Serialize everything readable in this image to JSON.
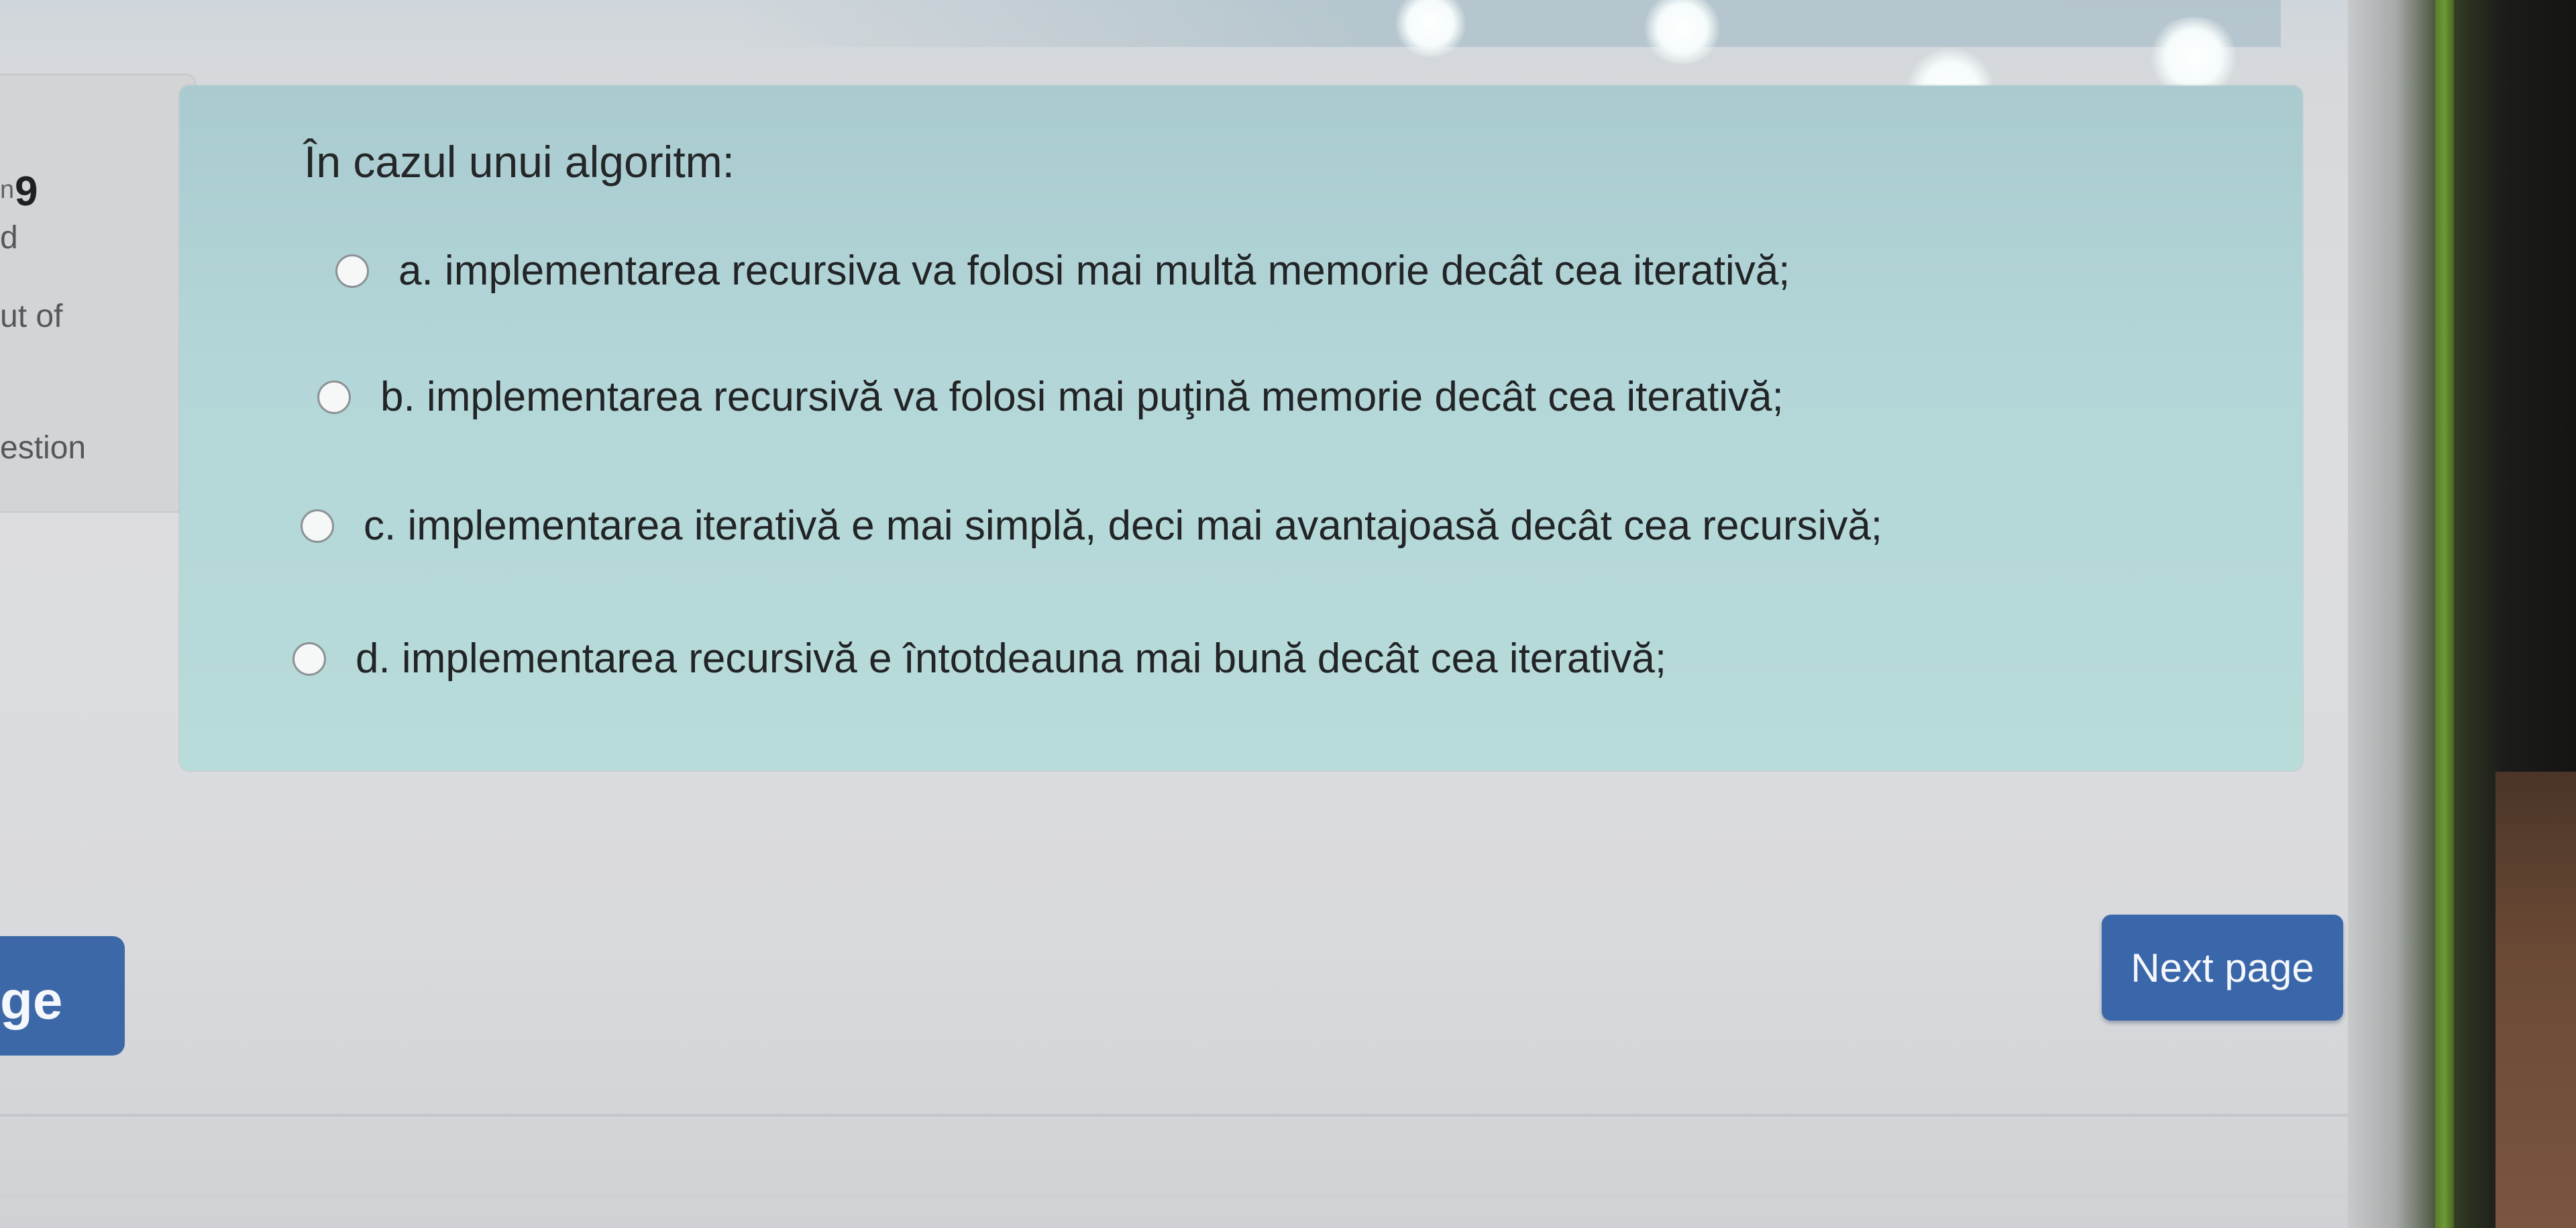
{
  "info_panel": {
    "question_prefix": "n",
    "question_number": "9",
    "status_fragment": "d",
    "marks_fragment": "ut of",
    "flag_fragment": "estion"
  },
  "question": {
    "text": "În cazul unui algoritm:",
    "options": [
      {
        "label": "a. implementarea recursiva va folosi mai multă memorie decât cea iterativă;"
      },
      {
        "label": "b. implementarea recursivă va folosi mai puţină memorie decât cea iterativă;"
      },
      {
        "label": "c. implementarea iterativă e mai simplă, deci mai avantajoasă decât cea recursivă;"
      },
      {
        "label": "d. implementarea recursivă e întotdeauna mai bună decât cea iterativă;"
      }
    ]
  },
  "navigation": {
    "previous_fragment": "ge",
    "next_label": "Next page"
  },
  "colors": {
    "question_background": "#b3d6d8",
    "button_primary": "#3a66aa"
  }
}
